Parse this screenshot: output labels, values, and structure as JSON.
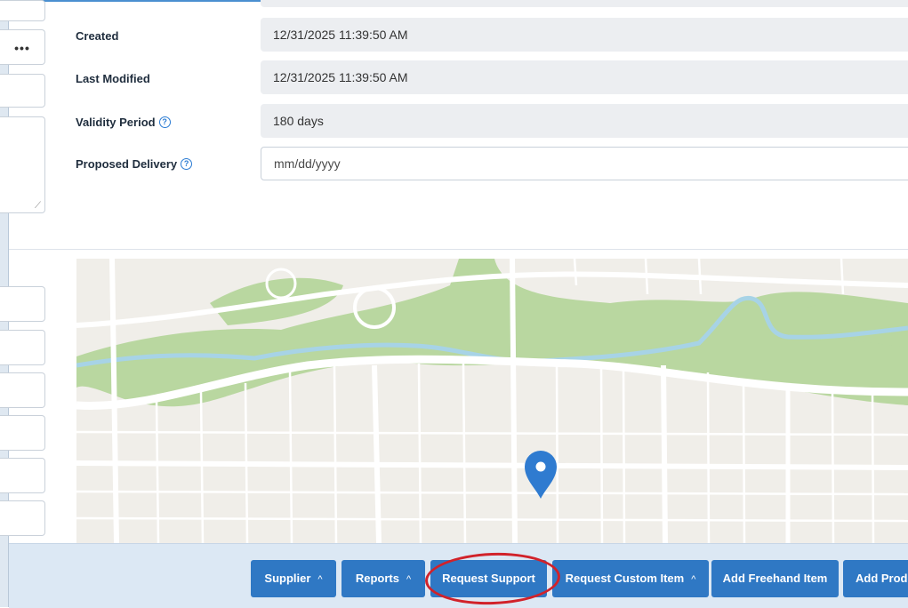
{
  "form": {
    "created": {
      "label": "Created",
      "value": "12/31/2025 11:39:50 AM"
    },
    "last_modified": {
      "label": "Last Modified",
      "value": "12/31/2025 11:39:50 AM"
    },
    "validity_period": {
      "label": "Validity Period",
      "value": "180 days"
    },
    "proposed_delivery": {
      "label": "Proposed Delivery",
      "placeholder": "mm/dd/yyyy"
    },
    "help_glyph": "?",
    "more_glyph": "•••"
  },
  "map": {
    "marker_color": "#2f7bd0",
    "park_color": "#b9d7a0",
    "river_color": "#a7d3e6",
    "road_color": "#ffffff"
  },
  "toolbar": {
    "supplier": "Supplier",
    "reports": "Reports",
    "request_support": "Request Support",
    "request_custom_item": "Request Custom Item",
    "add_freehand_item": "Add Freehand Item",
    "add_product": "Add Produ",
    "caret": "^"
  },
  "colors": {
    "button": "#2f78c4",
    "highlight_circle": "#d1222a"
  }
}
